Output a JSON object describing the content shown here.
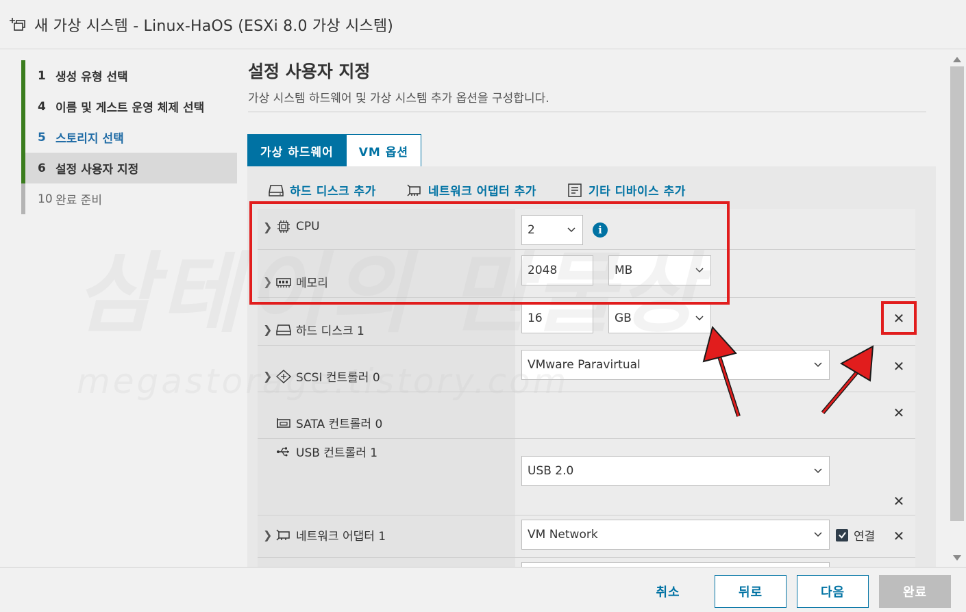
{
  "window": {
    "title": "새 가상 시스템 - Linux-HaOS (ESXi 8.0 가상 시스템)"
  },
  "steps": [
    {
      "num": "1",
      "label": "생성 유형 선택",
      "state": "done"
    },
    {
      "num": "4",
      "label": "이름 및 게스트 운영 체제 선택",
      "state": "done"
    },
    {
      "num": "5",
      "label": "스토리지 선택",
      "state": "link"
    },
    {
      "num": "6",
      "label": "설정 사용자 지정",
      "state": "current"
    },
    {
      "num": "10",
      "label": "완료 준비",
      "state": "pending"
    }
  ],
  "main": {
    "title": "설정 사용자 지정",
    "description": "가상 시스템 하드웨어 및 가상 시스템 추가 옵션을 구성합니다."
  },
  "tabs": [
    {
      "label": "가상 하드웨어",
      "active": true
    },
    {
      "label": "VM 옵션",
      "active": false
    }
  ],
  "actions": {
    "add_disk": "하드 디스크 추가",
    "add_network": "네트워크 어댑터 추가",
    "add_other": "기타 디바이스 추가"
  },
  "hardware": {
    "cpu": {
      "label": "CPU",
      "value": "2"
    },
    "memory": {
      "label": "메모리",
      "value": "2048",
      "unit": "MB"
    },
    "disk": {
      "label": "하드 디스크 1",
      "value": "16",
      "unit": "GB"
    },
    "scsi": {
      "label": "SCSI 컨트롤러 0",
      "value": "VMware Paravirtual"
    },
    "sata": {
      "label": "SATA 컨트롤러 0"
    },
    "usb": {
      "label": "USB 컨트롤러 1",
      "value": "USB 2.0"
    },
    "network": {
      "label": "네트워크 어댑터 1",
      "value": "VM Network",
      "connect_label": "연결",
      "connected": true
    }
  },
  "footer": {
    "cancel": "취소",
    "back": "뒤로",
    "next": "다음",
    "finish": "완료"
  },
  "watermark": {
    "main": "삼테이의 만물상",
    "sub": "megastorage.tistory.com"
  },
  "colors": {
    "accent": "#0072a3",
    "step_done": "#3b7d1e",
    "highlight": "#e11d1d"
  }
}
